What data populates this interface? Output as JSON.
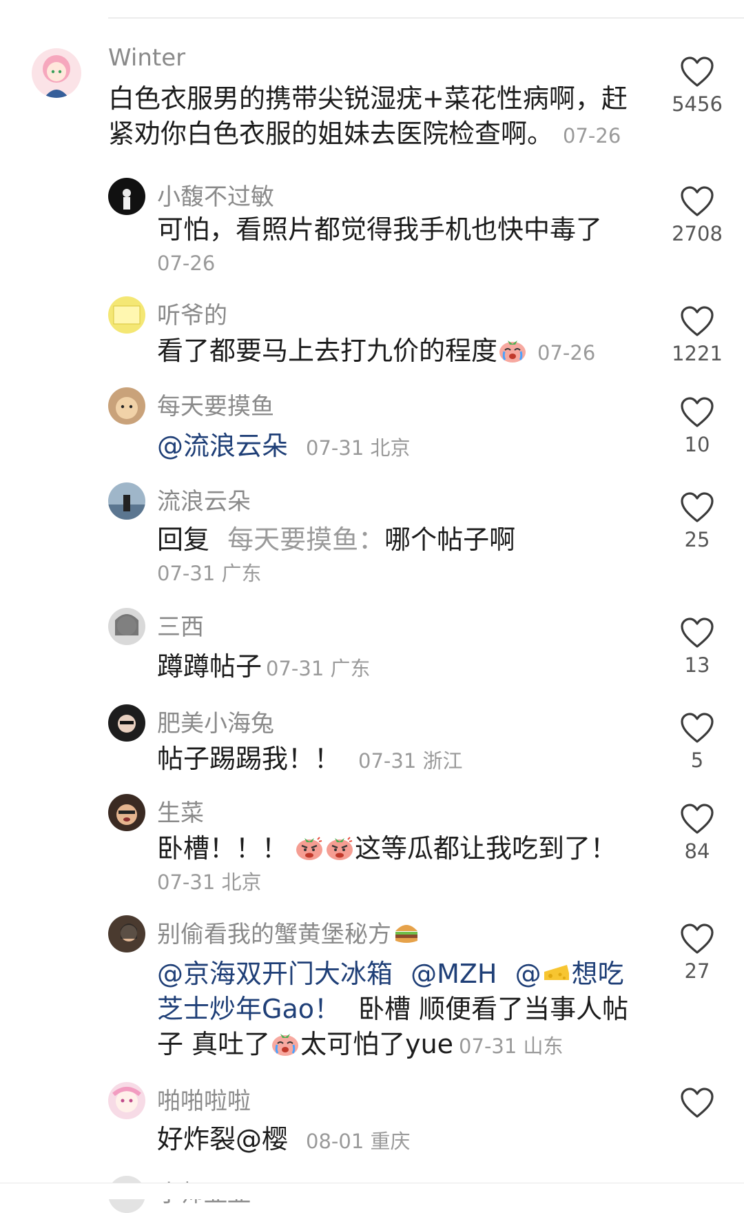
{
  "comments": [
    {
      "username": "Winter",
      "text": "白色衣服男的携带尖锐湿疣+菜花性病啊，赶紧劝你白色衣服的姐妹去医院检查啊。",
      "meta": "07-26",
      "likes": "5456"
    },
    {
      "username": "小馥不过敏",
      "text": "可怕，看照片都觉得我手机也快中毒了",
      "meta": "07-26",
      "likes": "2708"
    },
    {
      "username": "听爷的",
      "text": "看了都要马上去打九价的程度",
      "meta": "07-26",
      "likes": "1221"
    },
    {
      "username": "每天要摸鱼",
      "mention": "@流浪云朵",
      "meta": "07-31 北京",
      "likes": "10"
    },
    {
      "username": "流浪云朵",
      "reply_prefix": "回复",
      "reply_to": "每天要摸鱼：",
      "text": "哪个帖子啊",
      "meta": "07-31 广东",
      "likes": "25"
    },
    {
      "username": "三西",
      "text": "蹲蹲帖子",
      "meta": "07-31 广东",
      "likes": "13"
    },
    {
      "username": "肥美小海兔",
      "text": "帖子踢踢我！！",
      "meta": "07-31 浙江",
      "likes": "5"
    },
    {
      "username": "生菜",
      "text_a": "卧槽！！！",
      "text_b": "这等瓜都让我吃到了！",
      "meta": "07-31 北京",
      "likes": "84"
    },
    {
      "username": "别偷看我的蟹黄堡秘方",
      "mention_1": "@京海双开门大冰箱",
      "mention_2": "@MZH",
      "mention_3_a": "@",
      "mention_3_b": "想吃芝士炒年Gao！",
      "text_a": "卧槽 顺便看了当事人帖子 真吐了",
      "text_b": "太可怕了yue",
      "meta": "07-31 山东",
      "likes": "27"
    },
    {
      "username": "啪啪啦啦",
      "text": "好炸裂@樱",
      "meta": "08-01 重庆",
      "likes": ""
    },
    {
      "username": "小师显显"
    }
  ],
  "icons": {
    "like": "heart-outline-icon",
    "crying": "crying-face-emoji",
    "angry": "angry-face-emoji",
    "burger": "hamburger-emoji",
    "cheese": "cheese-emoji"
  },
  "colors": {
    "mention": "#1f3f77",
    "muted": "#9a9a9a",
    "text": "#1c1c1c"
  }
}
